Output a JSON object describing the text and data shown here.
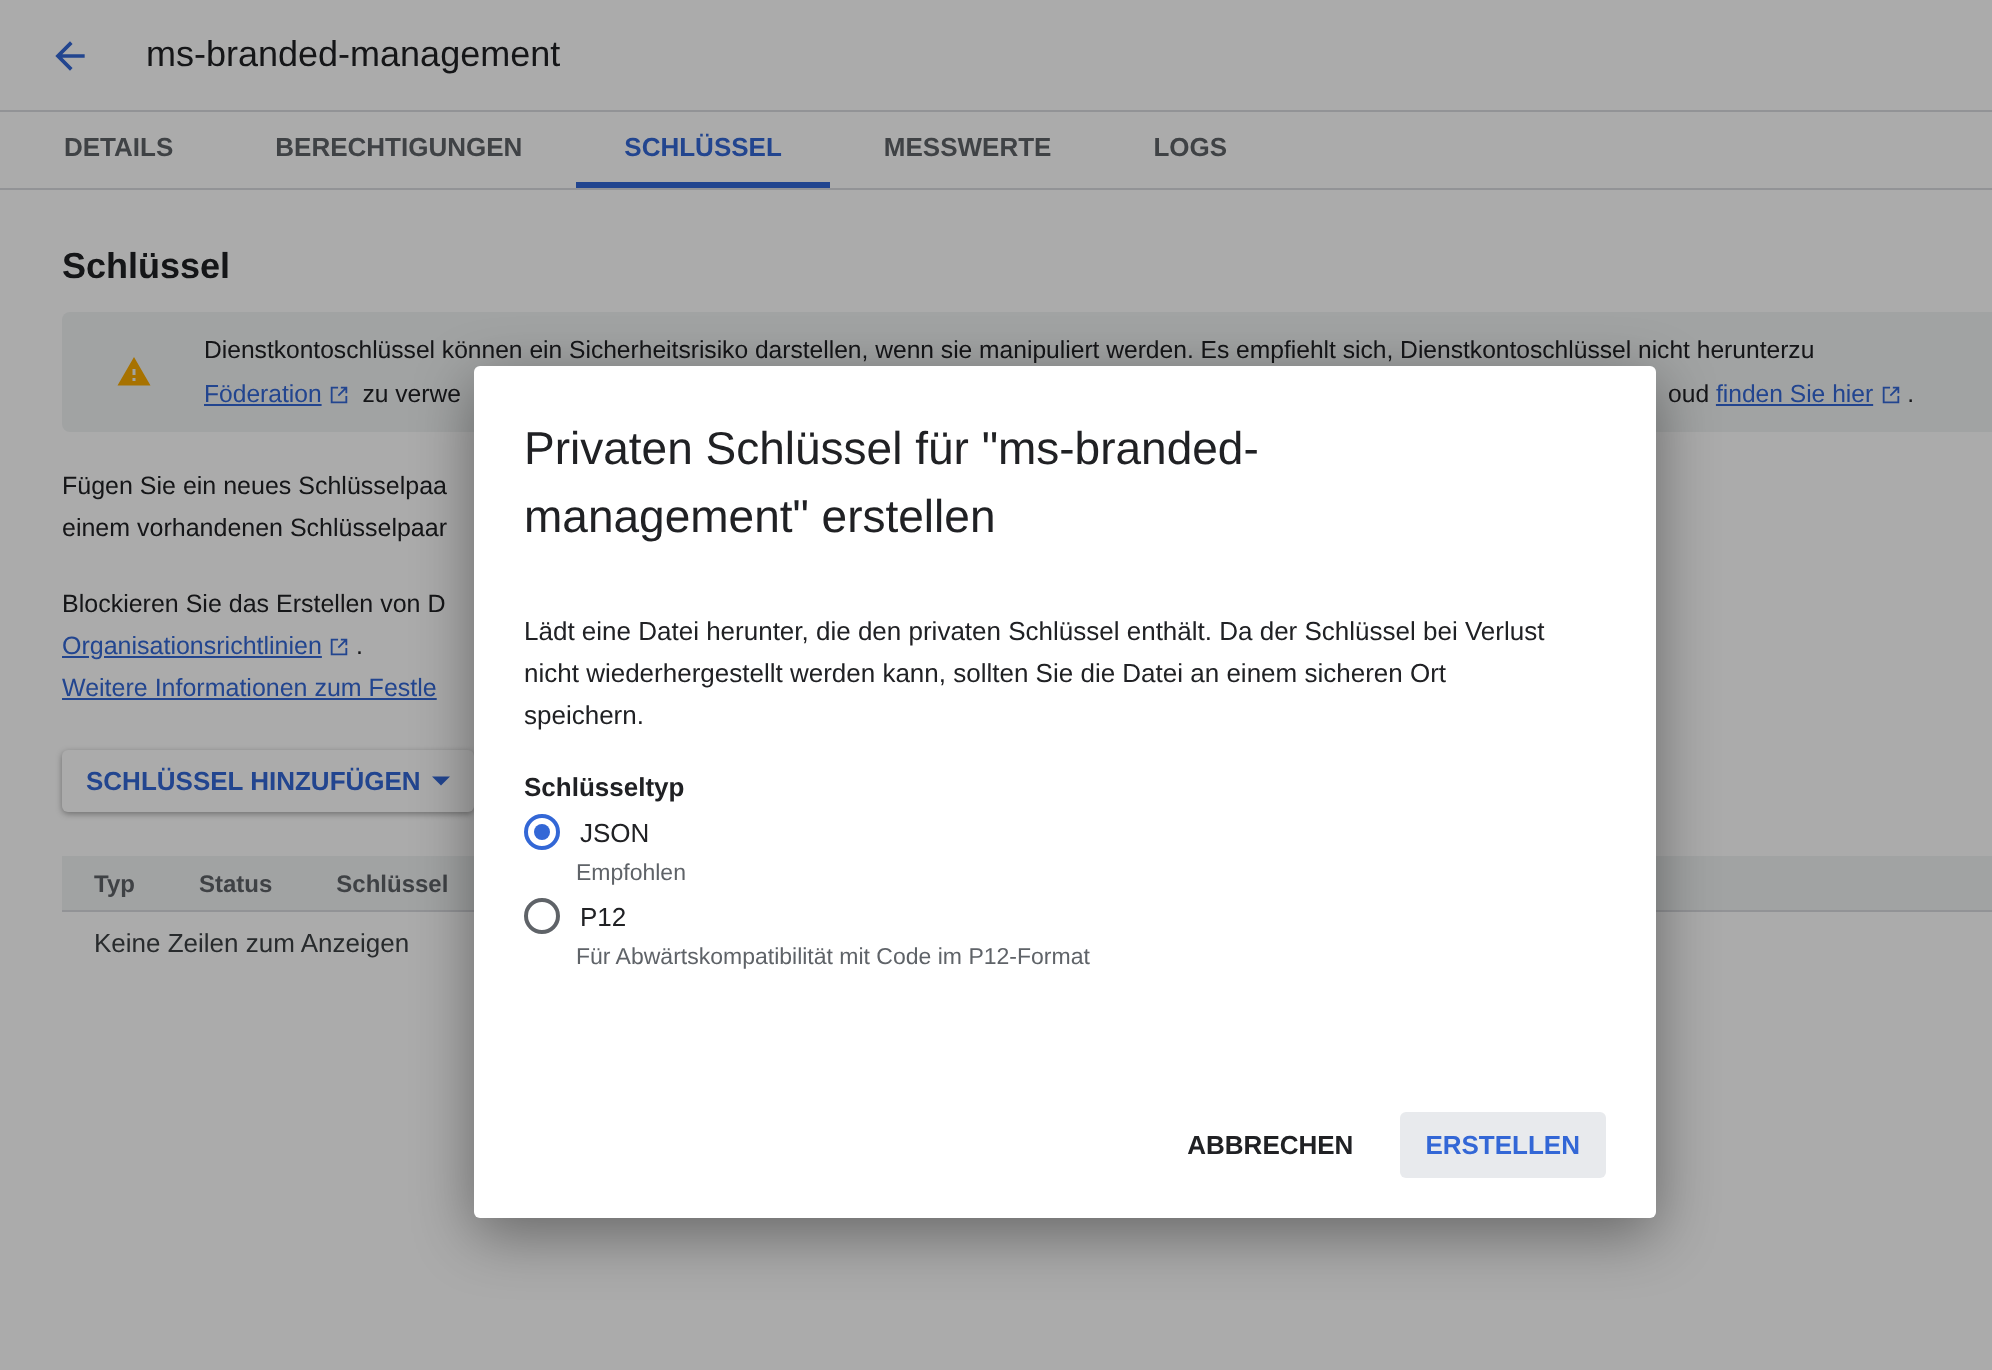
{
  "header": {
    "title": "ms-branded-management"
  },
  "tabs": [
    {
      "label": "DETAILS",
      "selected": false
    },
    {
      "label": "BERECHTIGUNGEN",
      "selected": false
    },
    {
      "label": "SCHLÜSSEL",
      "selected": true
    },
    {
      "label": "MESSWERTE",
      "selected": false
    },
    {
      "label": "LOGS",
      "selected": false
    }
  ],
  "section_title": "Schlüssel",
  "banner": {
    "line_1": "Dienstkontoschlüssel können ein Sicherheitsrisiko darstellen, wenn sie manipuliert werden. Es empfiehlt sich, Dienstkontoschlüssel nicht herunterzu",
    "link_left": "Föderation",
    "text_left": " zu verwe",
    "text_right": "oud ",
    "link_right": "finden Sie hier",
    "end": "."
  },
  "paragraph_1": [
    "Fügen Sie ein neues Schlüsselpaa",
    "einem vorhandenen Schlüsselpaar"
  ],
  "paragraph_2": {
    "line_1": "Blockieren Sie das Erstellen von D",
    "policy_link": "Organisationsrichtlinien",
    "policy_end": ".",
    "more_link": "Weitere Informationen zum Festle"
  },
  "add_key_button": "SCHLÜSSEL HINZUFÜGEN",
  "table": {
    "columns": [
      "Typ",
      "Status",
      "Schlüssel"
    ],
    "empty_text": "Keine Zeilen zum Anzeigen"
  },
  "dialog": {
    "title": "Privaten Schlüssel für \"ms-branded-management\" erstellen",
    "description": "Lädt eine Datei herunter, die den privaten Schlüssel enthält. Da der Schlüssel bei Verlust nicht wiederhergestellt werden kann, sollten Sie die Datei an einem sicheren Ort speichern.",
    "group_label": "Schlüsseltyp",
    "options": [
      {
        "label": "JSON",
        "hint": "Empfohlen",
        "selected": true
      },
      {
        "label": "P12",
        "hint": "Für Abwärtskompatibilität mit Code im P12-Format",
        "selected": false
      }
    ],
    "buttons": [
      {
        "label": "ABBRECHEN",
        "kind": "text"
      },
      {
        "label": "ERSTELLEN",
        "kind": "primary"
      }
    ]
  }
}
